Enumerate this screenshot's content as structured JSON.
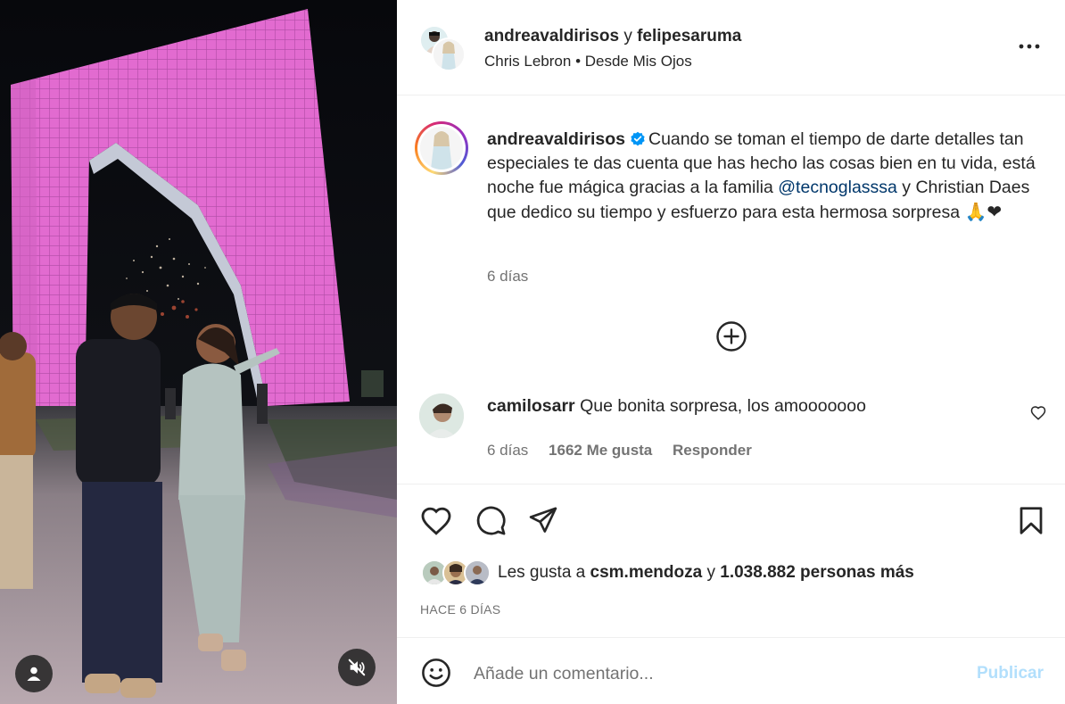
{
  "post": {
    "accounts": {
      "primary": "andreavaldirisos",
      "conjunction": "y",
      "collaborator": "felipesaruma"
    },
    "audio": {
      "artist": "Chris Lebron",
      "separator": "•",
      "track": "Desde Mis Ojos"
    }
  },
  "caption": {
    "username": "andreavaldirisos",
    "text_before": "Cuando se toman el tiempo de darte detalles tan especiales te das cuenta que has hecho las cosas bien en tu vida, está noche fue mágica gracias a la familia ",
    "mention": "@tecnoglasssa",
    "text_after": " y Christian Daes que dedico su tiempo y esfuerzo para esta hermosa sorpresa ",
    "emojis": "🙏❤",
    "time": "6 días"
  },
  "comment": {
    "username": "camilosarr",
    "text": "Que bonita sorpresa, los amooooooo",
    "time": "6 días",
    "likes": "1662 Me gusta",
    "reply": "Responder"
  },
  "likes": {
    "prefix": "Les gusta a",
    "liked_by": "csm.mendoza",
    "conjunction": "y",
    "others": "1.038.882 personas más"
  },
  "time_ago": "HACE 6 DÍAS",
  "add_comment": {
    "placeholder": "Añade un comentario...",
    "publish": "Publicar"
  },
  "colors": {
    "text": "#262626",
    "secondary": "#737373",
    "link": "#00376b",
    "publish_disabled": "#b2dffc",
    "verified": "#0095f6",
    "heart": "#e0245e"
  },
  "icons": {
    "more": "more-horizontal-icon",
    "verified": "verified-badge-icon",
    "load_more": "plus-circle-icon",
    "like": "heart-icon",
    "comment": "comment-bubble-icon",
    "share": "paper-plane-icon",
    "save": "bookmark-icon",
    "emoji": "smiley-icon",
    "user_tag": "user-icon",
    "mute": "speaker-muted-icon"
  }
}
